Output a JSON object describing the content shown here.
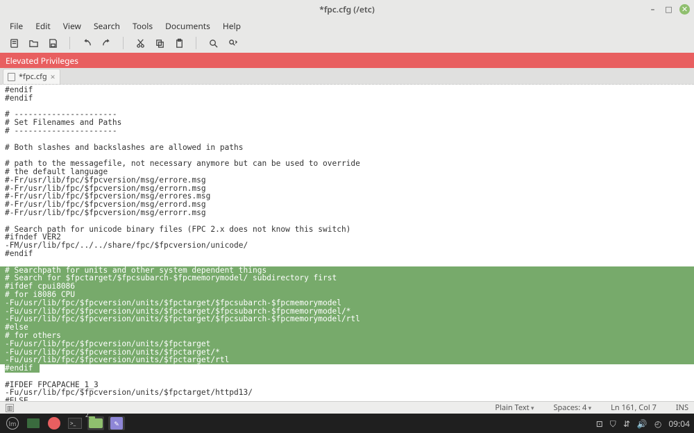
{
  "window": {
    "title": "*fpc.cfg (/etc)"
  },
  "menu": [
    "File",
    "Edit",
    "View",
    "Search",
    "Tools",
    "Documents",
    "Help"
  ],
  "elevated": "Elevated Privileges",
  "tab": {
    "name": "*fpc.cfg"
  },
  "editor": {
    "pre": [
      "#endif",
      "#endif",
      "",
      "# ----------------------",
      "# Set Filenames and Paths",
      "# ----------------------",
      "",
      "# Both slashes and backslashes are allowed in paths",
      "",
      "# path to the messagefile, not necessary anymore but can be used to override",
      "# the default language",
      "#-Fr/usr/lib/fpc/$fpcversion/msg/errore.msg",
      "#-Fr/usr/lib/fpc/$fpcversion/msg/errorn.msg",
      "#-Fr/usr/lib/fpc/$fpcversion/msg/errores.msg",
      "#-Fr/usr/lib/fpc/$fpcversion/msg/errord.msg",
      "#-Fr/usr/lib/fpc/$fpcversion/msg/errorr.msg",
      "",
      "# Search path for unicode binary files (FPC 2.x does not know this switch)",
      "#ifndef VER2",
      "-FM/usr/lib/fpc/../../share/fpc/$fpcversion/unicode/",
      "#endif",
      ""
    ],
    "selected": [
      "# Searchpath for units and other system dependent things",
      "# Search for $fpctarget/$fpcsubarch-$fpcmemorymodel/ subdirectory first",
      "#ifdef cpui8086",
      "# for i8086 CPU",
      "-Fu/usr/lib/fpc/$fpcversion/units/$fpctarget/$fpcsubarch-$fpcmemorymodel",
      "-Fu/usr/lib/fpc/$fpcversion/units/$fpctarget/$fpcsubarch-$fpcmemorymodel/*",
      "-Fu/usr/lib/fpc/$fpcversion/units/$fpctarget/$fpcsubarch-$fpcmemorymodel/rtl",
      "#else",
      "# for others",
      "-Fu/usr/lib/fpc/$fpcversion/units/$fpctarget",
      "-Fu/usr/lib/fpc/$fpcversion/units/$fpctarget/*",
      "-Fu/usr/lib/fpc/$fpcversion/units/$fpctarget/rtl"
    ],
    "selected_last": "#endif",
    "post": [
      "",
      "#IFDEF FPCAPACHE_1_3",
      "-Fu/usr/lib/fpc/$fpcversion/units/$fpctarget/httpd13/",
      "#ELSE"
    ]
  },
  "status": {
    "syntax": "Plain Text",
    "spaces": "Spaces: 4",
    "position": "Ln 161, Col 7",
    "mode": "INS"
  },
  "taskbar": {
    "folder_badge": "2",
    "time": "09:04"
  }
}
